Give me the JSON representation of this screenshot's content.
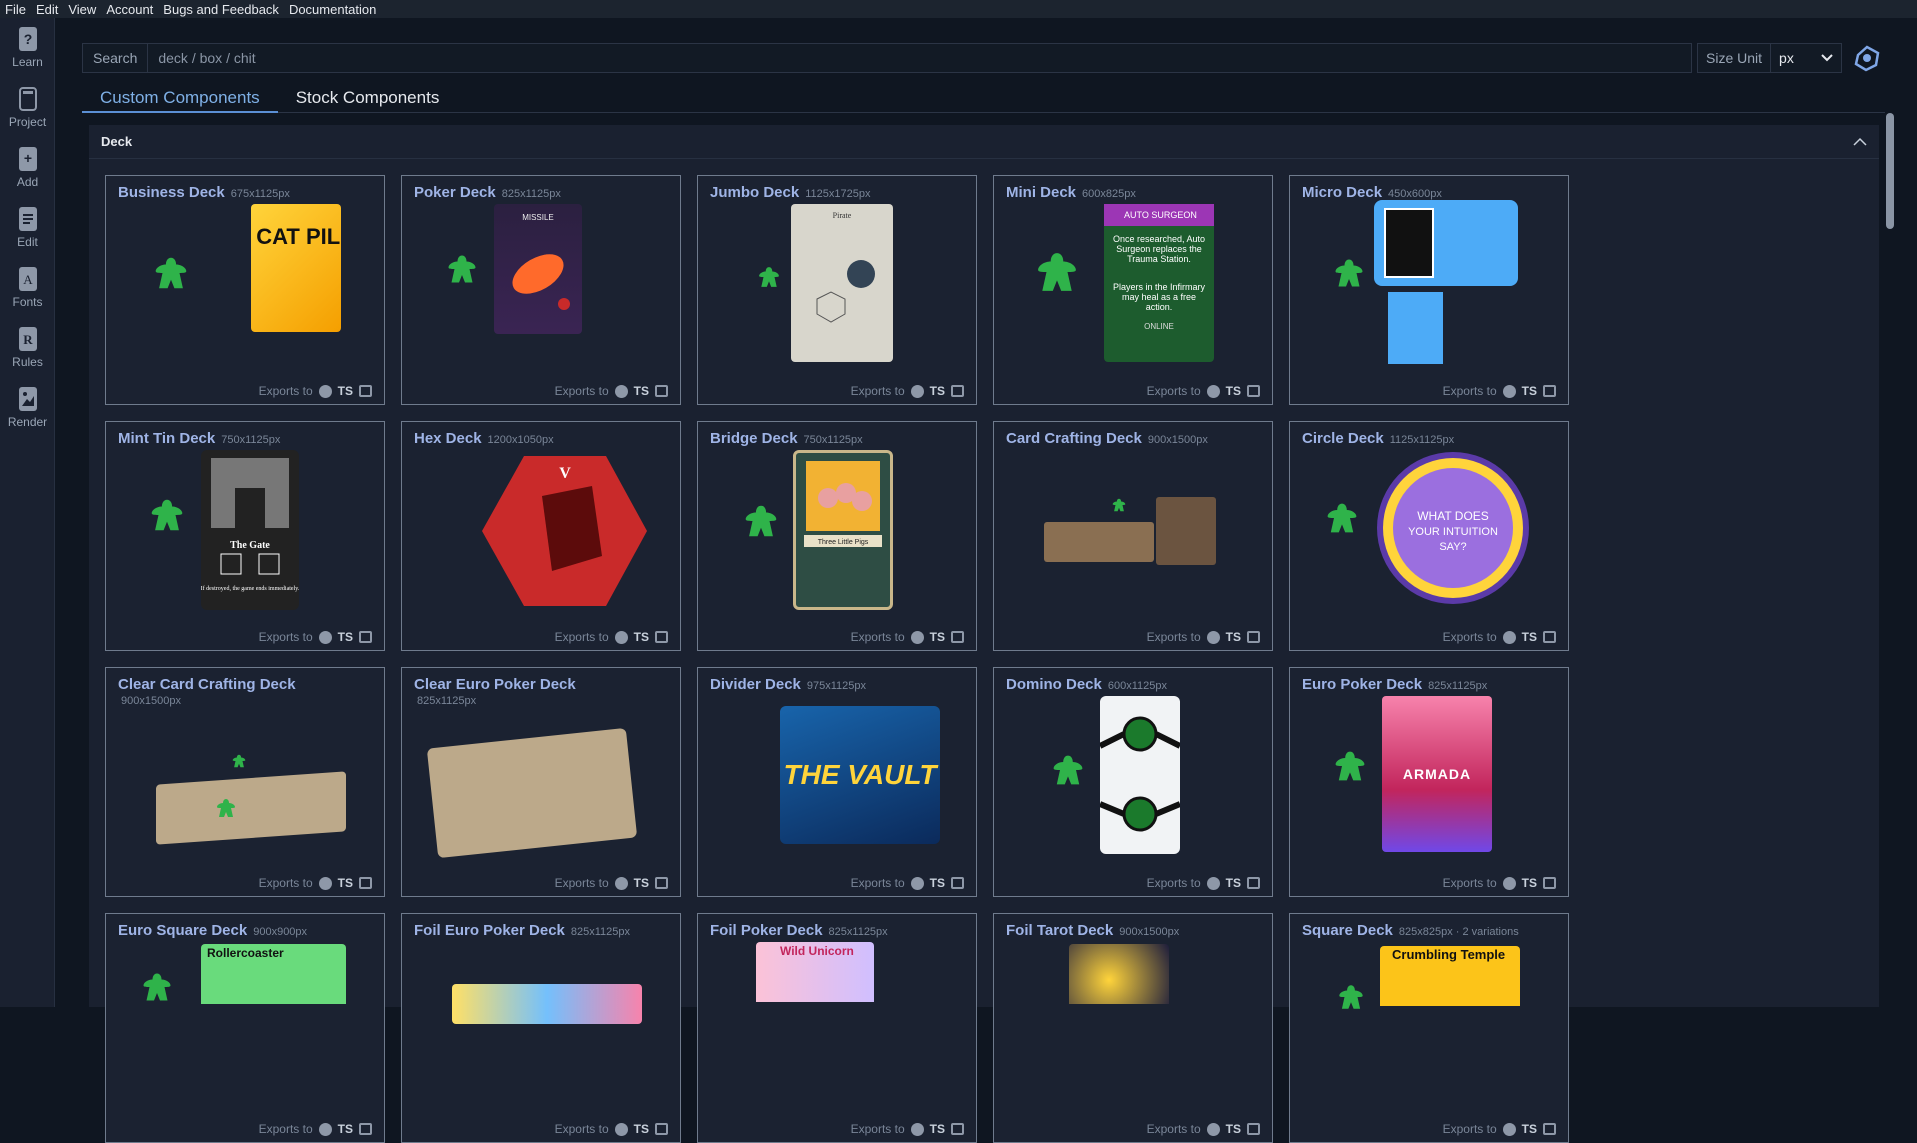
{
  "menu": [
    "File",
    "Edit",
    "View",
    "Account",
    "Bugs and Feedback",
    "Documentation"
  ],
  "sidebar": [
    {
      "label": "Learn",
      "icon": "question-icon"
    },
    {
      "label": "Project",
      "icon": "page-icon"
    },
    {
      "label": "Add",
      "icon": "add-icon"
    },
    {
      "label": "Edit",
      "icon": "edit-icon"
    },
    {
      "label": "Fonts",
      "icon": "fonts-icon"
    },
    {
      "label": "Rules",
      "icon": "rules-icon"
    },
    {
      "label": "Render",
      "icon": "render-icon"
    }
  ],
  "search": {
    "label": "Search",
    "placeholder": "deck / box / chit"
  },
  "size_unit": {
    "label": "Size Unit",
    "value": "px"
  },
  "tabs": [
    "Custom Components",
    "Stock Components"
  ],
  "section": {
    "title": "Deck"
  },
  "exports_label": "Exports to",
  "ts_label": "TS",
  "colors": {
    "accent": "#7fb0e6",
    "card_title": "#9fb4e6",
    "bg": "#0f1621",
    "panel": "#1a2130",
    "meeple": "#2fb34a"
  },
  "cards": [
    {
      "title": "Business Deck",
      "size": "675x1125px"
    },
    {
      "title": "Poker Deck",
      "size": "825x1125px"
    },
    {
      "title": "Jumbo Deck",
      "size": "1125x1725px"
    },
    {
      "title": "Mini Deck",
      "size": "600x825px"
    },
    {
      "title": "Micro Deck",
      "size": "450x600px"
    },
    {
      "title": "Mint Tin Deck",
      "size": "750x1125px"
    },
    {
      "title": "Hex Deck",
      "size": "1200x1050px"
    },
    {
      "title": "Bridge Deck",
      "size": "750x1125px"
    },
    {
      "title": "Card Crafting Deck",
      "size": "900x1500px"
    },
    {
      "title": "Circle Deck",
      "size": "1125x1125px"
    },
    {
      "title": "Clear Card Crafting Deck",
      "size": "900x1500px"
    },
    {
      "title": "Clear Euro Poker Deck",
      "size": "825x1125px"
    },
    {
      "title": "Divider Deck",
      "size": "975x1125px"
    },
    {
      "title": "Domino Deck",
      "size": "600x1125px"
    },
    {
      "title": "Euro Poker Deck",
      "size": "825x1125px"
    },
    {
      "title": "Euro Square Deck",
      "size": "900x900px"
    },
    {
      "title": "Foil Euro Poker Deck",
      "size": "825x1125px"
    },
    {
      "title": "Foil Poker Deck",
      "size": "825x1125px"
    },
    {
      "title": "Foil Tarot Deck",
      "size": "900x1500px"
    },
    {
      "title": "Square Deck",
      "size": "825x825px · 2 variations"
    }
  ],
  "card_art_text": {
    "cat": "CAT CAT PILLAR",
    "missile": "MISSILE",
    "pirate": "Pirate",
    "auto_surgeon": "AUTO SURGEON",
    "auto_surgeon_body": "Once researched, Auto Surgeon replaces the Trauma Station.",
    "auto_surgeon_body2": "Players in the Infirmary may heal as a free action.",
    "online": "ONLINE",
    "gate": "The Gate",
    "gate_body": "If destroyed, the game ends immediately.",
    "hex_v": "V",
    "pigs": "Three Little Pigs",
    "intuition": "WHAT DOES YOUR INTUITION SAY?",
    "vault": "THE VAULT",
    "armada": "ARMADA",
    "rollercoaster": "Rollercoaster",
    "unicorn": "Wild Unicorn",
    "temple": "Crumbling Temple"
  }
}
